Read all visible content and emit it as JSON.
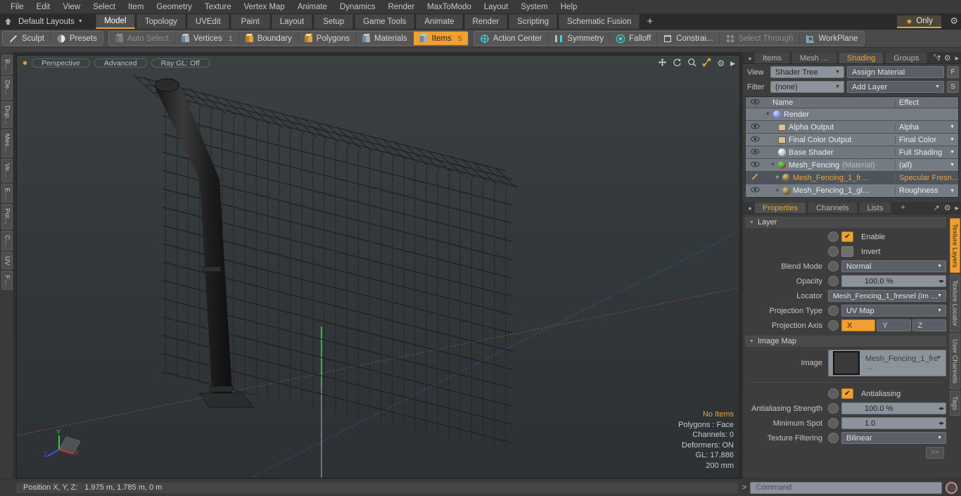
{
  "menu": {
    "items": [
      "File",
      "Edit",
      "View",
      "Select",
      "Item",
      "Geometry",
      "Texture",
      "Vertex Map",
      "Animate",
      "Dynamics",
      "Render",
      "MaxToModo",
      "Layout",
      "System",
      "Help"
    ]
  },
  "layoutbar": {
    "home_icon": "home-icon",
    "layout_name": "Default Layouts",
    "tabs": [
      {
        "label": "Model",
        "active": true
      },
      {
        "label": "Topology",
        "active": false
      },
      {
        "label": "UVEdit",
        "active": false
      },
      {
        "label": "Paint",
        "active": false
      },
      {
        "label": "Layout",
        "active": false
      },
      {
        "label": "Setup",
        "active": false
      },
      {
        "label": "Game Tools",
        "active": false
      },
      {
        "label": "Animate",
        "active": false
      },
      {
        "label": "Render",
        "active": false
      },
      {
        "label": "Scripting",
        "active": false
      },
      {
        "label": "Schematic Fusion",
        "active": false
      }
    ],
    "add_tab": "+",
    "only_label": "Only",
    "star_glyph": "★",
    "gear_glyph": "⚙"
  },
  "toolbar": {
    "group1": [
      {
        "label": "Sculpt",
        "icon": "pencil-icon",
        "state": "normal"
      },
      {
        "label": "Presets",
        "icon": "sphere-icon",
        "state": "normal"
      }
    ],
    "group2": [
      {
        "label": "Auto Select",
        "icon": "cube-icon",
        "state": "dim",
        "badge": ""
      },
      {
        "label": "Vertices",
        "icon": "cube-icon",
        "state": "normal",
        "badge": "1"
      },
      {
        "label": "Boundary",
        "icon": "cube-icon",
        "state": "normal",
        "badge": ""
      },
      {
        "label": "Polygons",
        "icon": "cube-icon",
        "state": "normal",
        "badge": ""
      },
      {
        "label": "Materials",
        "icon": "cube-icon",
        "state": "normal",
        "badge": ""
      },
      {
        "label": "Items",
        "icon": "cube-icon",
        "state": "selected",
        "badge": "5"
      }
    ],
    "group3": [
      {
        "label": "Action Center",
        "icon": "crosshair-icon",
        "state": "normal"
      },
      {
        "label": "Symmetry",
        "icon": "mirror-icon",
        "state": "normal"
      },
      {
        "label": "Falloff",
        "icon": "target-icon",
        "state": "normal"
      },
      {
        "label": "Constrai...",
        "icon": "constraint-icon",
        "state": "normal"
      },
      {
        "label": "Select Through",
        "icon": "selectthrough-icon",
        "state": "dim"
      },
      {
        "label": "WorkPlane",
        "icon": "workplane-icon",
        "state": "normal"
      }
    ]
  },
  "left_rail": {
    "tabs": [
      "B…",
      "De…",
      "Dup…",
      "Mes…",
      "Ve…",
      "E…",
      "Pol…",
      "C…",
      "UV",
      "F…"
    ]
  },
  "viewport": {
    "pills": [
      "Perspective",
      "Advanced",
      "Ray GL: Off"
    ],
    "tool_icons": [
      "move-icon",
      "rotate-icon",
      "zoom-icon",
      "fit-icon",
      "gear-icon",
      "play-icon"
    ],
    "stats": {
      "selection": "No Items",
      "polygons": "Polygons : Face",
      "channels": "Channels: 0",
      "deformers": "Deformers: ON",
      "gl": "GL: 17,886",
      "grid": "200 mm"
    },
    "gizmo_axes": [
      "X",
      "Y",
      "Z"
    ],
    "axis_colors": {
      "x": "#c0392b",
      "y": "#2ecc40",
      "z": "#2d5fe0"
    }
  },
  "right_panel": {
    "tabs": [
      {
        "label": "Items",
        "active": false
      },
      {
        "label": "Mesh …",
        "active": false
      },
      {
        "label": "Shading",
        "active": true
      },
      {
        "label": "Groups",
        "active": false
      }
    ],
    "tab_extra_glyphs": [
      "▼",
      "⤡",
      "⚙",
      "▶"
    ],
    "view_row": {
      "label": "View",
      "value": "Shader Tree",
      "action": "Assign Material",
      "button": "F"
    },
    "filter_row": {
      "label": "Filter",
      "value": "(none)",
      "action": "Add Layer",
      "button": "S"
    },
    "tree": {
      "headers": {
        "eye": "eye-icon",
        "name": "Name",
        "effect": "Effect"
      },
      "rows": [
        {
          "eye": "none",
          "indent": 0,
          "expander": "▼",
          "icon": "render-sphere-icon",
          "name": "Render",
          "suffix": "",
          "effect": "",
          "dropdown": false,
          "selected": false
        },
        {
          "eye": "eye",
          "indent": 1,
          "expander": "",
          "icon": "image-output-icon",
          "name": "Alpha Output",
          "suffix": "",
          "effect": "Alpha",
          "dropdown": true,
          "selected": false
        },
        {
          "eye": "eye",
          "indent": 1,
          "expander": "",
          "icon": "image-output-icon",
          "name": "Final Color Output",
          "suffix": "",
          "effect": "Final Color",
          "dropdown": true,
          "selected": false
        },
        {
          "eye": "eye",
          "indent": 1,
          "expander": "",
          "icon": "base-shader-icon",
          "name": "Base Shader",
          "suffix": "",
          "effect": "Full Shading",
          "dropdown": true,
          "selected": false
        },
        {
          "eye": "eye",
          "indent": 1,
          "expander": "▼",
          "icon": "material-icon",
          "name": "Mesh_Fencing",
          "suffix": "(Material)",
          "effect": "(all)",
          "dropdown": true,
          "selected": false
        },
        {
          "eye": "brush",
          "indent": 2,
          "expander": "+",
          "icon": "texture-icon",
          "name": "Mesh_Fencing_1_fr…",
          "suffix": "",
          "effect": "Specular Fresn…",
          "dropdown": false,
          "selected": true
        },
        {
          "eye": "eye",
          "indent": 2,
          "expander": "+",
          "icon": "texture-icon",
          "name": "Mesh_Fencing_1_gl…",
          "suffix": "",
          "effect": "Roughness",
          "dropdown": true,
          "selected": false
        }
      ]
    }
  },
  "properties": {
    "tabs": [
      {
        "label": "Properties",
        "active": true
      },
      {
        "label": "Channels",
        "active": false
      },
      {
        "label": "Lists",
        "active": false
      },
      {
        "label": "+",
        "active": false
      }
    ],
    "layer_section": "Layer",
    "enable": {
      "label": "Enable",
      "checked": true
    },
    "invert": {
      "label": "Invert",
      "checked": false
    },
    "blend_mode": {
      "label": "Blend Mode",
      "value": "Normal"
    },
    "opacity": {
      "label": "Opacity",
      "value": "100.0 %"
    },
    "locator": {
      "label": "Locator",
      "value": "Mesh_Fencing_1_fresnel (Im …"
    },
    "projection_type": {
      "label": "Projection Type",
      "value": "UV Map"
    },
    "projection_axis": {
      "label": "Projection Axis",
      "options": [
        "X",
        "Y",
        "Z"
      ],
      "selected": "X"
    },
    "image_map_section": "Image Map",
    "image": {
      "label": "Image",
      "value": "Mesh_Fencing_1_fre …"
    },
    "antialiasing": {
      "label": "Antialiasing",
      "checked": true
    },
    "aa_strength": {
      "label": "Antialiasing Strength",
      "value": "100.0 %"
    },
    "minimum_spot": {
      "label": "Minimum Spot",
      "value": "1.0"
    },
    "texture_filtering": {
      "label": "Texture Filtering",
      "value": "Bilinear"
    },
    "more_button": ">>",
    "side_tabs": [
      {
        "label": "Texture Layers",
        "active": true
      },
      {
        "label": "Texture Locator",
        "active": false
      },
      {
        "label": "User Channels",
        "active": false
      },
      {
        "label": "Tags",
        "active": false
      }
    ]
  },
  "statusbar": {
    "position_label": "Position X, Y, Z:",
    "position_value": "1.975 m, 1.785 m, 0 m",
    "command_placeholder": "Command",
    "prompt_glyph": ">",
    "record_icon": "record-icon"
  },
  "colors": {
    "accent": "#f0a033",
    "panel": "#3d3d3d",
    "toolbar": "#4a4a4a",
    "field": "#8d939b",
    "viewport_bg": "#33383b"
  }
}
